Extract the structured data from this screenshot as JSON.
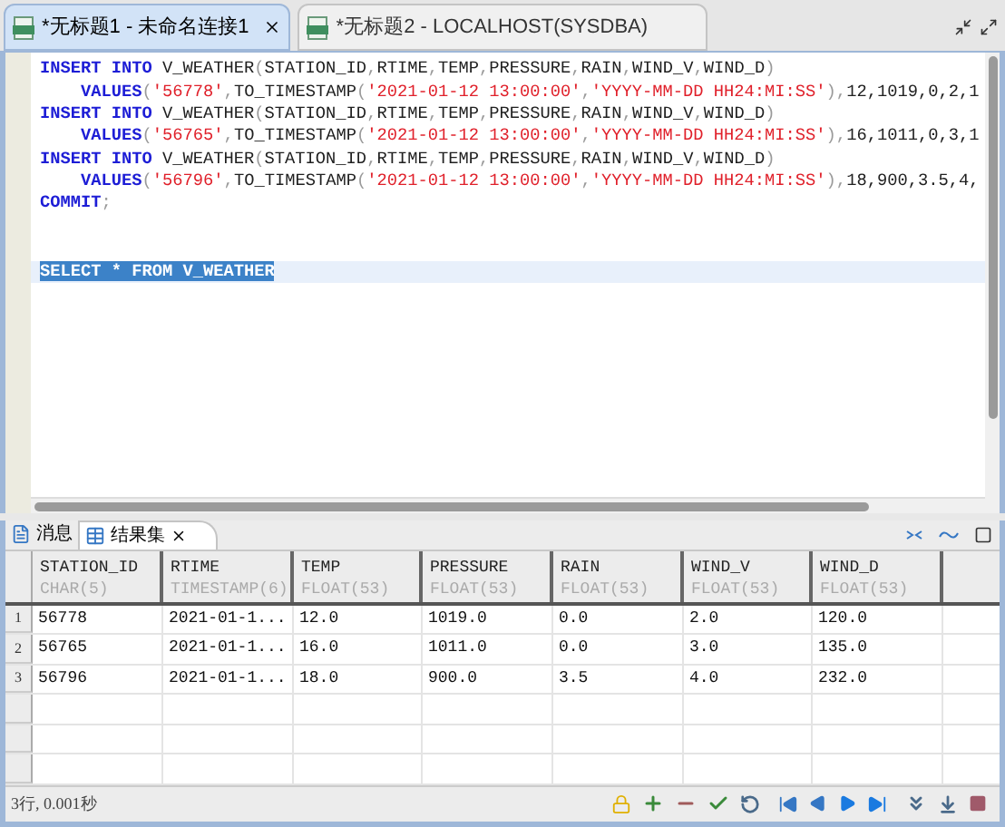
{
  "editor_tabs": [
    {
      "label": "*无标题1 - 未命名连接1",
      "selected": true,
      "closable": true
    },
    {
      "label": "*无标题2 - LOCALHOST(SYSDBA)",
      "selected": false,
      "closable": false
    }
  ],
  "sql_lines": [
    {
      "selected": false,
      "segments": [
        {
          "kind": "keyword",
          "text": "INSERT INTO"
        },
        {
          "kind": "plain",
          "text": " V_WEATHER"
        },
        {
          "kind": "punct",
          "text": "("
        },
        {
          "kind": "plain",
          "text": "STATION_ID"
        },
        {
          "kind": "punct",
          "text": ","
        },
        {
          "kind": "plain",
          "text": "RTIME"
        },
        {
          "kind": "punct",
          "text": ","
        },
        {
          "kind": "plain",
          "text": "TEMP"
        },
        {
          "kind": "punct",
          "text": ","
        },
        {
          "kind": "plain",
          "text": "PRESSURE"
        },
        {
          "kind": "punct",
          "text": ","
        },
        {
          "kind": "plain",
          "text": "RAIN"
        },
        {
          "kind": "punct",
          "text": ","
        },
        {
          "kind": "plain",
          "text": "WIND_V"
        },
        {
          "kind": "punct",
          "text": ","
        },
        {
          "kind": "plain",
          "text": "WIND_D"
        },
        {
          "kind": "punct",
          "text": ")"
        }
      ]
    },
    {
      "selected": false,
      "segments": [
        {
          "kind": "keyword",
          "text": "    VALUES"
        },
        {
          "kind": "punct",
          "text": "("
        },
        {
          "kind": "string",
          "text": "'56778'"
        },
        {
          "kind": "punct",
          "text": ","
        },
        {
          "kind": "plain",
          "text": "TO_TIMESTAMP"
        },
        {
          "kind": "punct",
          "text": "("
        },
        {
          "kind": "string",
          "text": "'2021-01-12 13:00:00'"
        },
        {
          "kind": "punct",
          "text": ","
        },
        {
          "kind": "string",
          "text": "'YYYY-MM-DD HH24:MI:SS'"
        },
        {
          "kind": "punct",
          "text": "),"
        },
        {
          "kind": "plain",
          "text": "12,1019,0,2,1"
        }
      ]
    },
    {
      "selected": false,
      "segments": [
        {
          "kind": "keyword",
          "text": "INSERT INTO"
        },
        {
          "kind": "plain",
          "text": " V_WEATHER"
        },
        {
          "kind": "punct",
          "text": "("
        },
        {
          "kind": "plain",
          "text": "STATION_ID"
        },
        {
          "kind": "punct",
          "text": ","
        },
        {
          "kind": "plain",
          "text": "RTIME"
        },
        {
          "kind": "punct",
          "text": ","
        },
        {
          "kind": "plain",
          "text": "TEMP"
        },
        {
          "kind": "punct",
          "text": ","
        },
        {
          "kind": "plain",
          "text": "PRESSURE"
        },
        {
          "kind": "punct",
          "text": ","
        },
        {
          "kind": "plain",
          "text": "RAIN"
        },
        {
          "kind": "punct",
          "text": ","
        },
        {
          "kind": "plain",
          "text": "WIND_V"
        },
        {
          "kind": "punct",
          "text": ","
        },
        {
          "kind": "plain",
          "text": "WIND_D"
        },
        {
          "kind": "punct",
          "text": ")"
        }
      ]
    },
    {
      "selected": false,
      "segments": [
        {
          "kind": "keyword",
          "text": "    VALUES"
        },
        {
          "kind": "punct",
          "text": "("
        },
        {
          "kind": "string",
          "text": "'56765'"
        },
        {
          "kind": "punct",
          "text": ","
        },
        {
          "kind": "plain",
          "text": "TO_TIMESTAMP"
        },
        {
          "kind": "punct",
          "text": "("
        },
        {
          "kind": "string",
          "text": "'2021-01-12 13:00:00'"
        },
        {
          "kind": "punct",
          "text": ","
        },
        {
          "kind": "string",
          "text": "'YYYY-MM-DD HH24:MI:SS'"
        },
        {
          "kind": "punct",
          "text": "),"
        },
        {
          "kind": "plain",
          "text": "16,1011,0,3,1"
        }
      ]
    },
    {
      "selected": false,
      "segments": [
        {
          "kind": "keyword",
          "text": "INSERT INTO"
        },
        {
          "kind": "plain",
          "text": " V_WEATHER"
        },
        {
          "kind": "punct",
          "text": "("
        },
        {
          "kind": "plain",
          "text": "STATION_ID"
        },
        {
          "kind": "punct",
          "text": ","
        },
        {
          "kind": "plain",
          "text": "RTIME"
        },
        {
          "kind": "punct",
          "text": ","
        },
        {
          "kind": "plain",
          "text": "TEMP"
        },
        {
          "kind": "punct",
          "text": ","
        },
        {
          "kind": "plain",
          "text": "PRESSURE"
        },
        {
          "kind": "punct",
          "text": ","
        },
        {
          "kind": "plain",
          "text": "RAIN"
        },
        {
          "kind": "punct",
          "text": ","
        },
        {
          "kind": "plain",
          "text": "WIND_V"
        },
        {
          "kind": "punct",
          "text": ","
        },
        {
          "kind": "plain",
          "text": "WIND_D"
        },
        {
          "kind": "punct",
          "text": ")"
        }
      ]
    },
    {
      "selected": false,
      "segments": [
        {
          "kind": "keyword",
          "text": "    VALUES"
        },
        {
          "kind": "punct",
          "text": "("
        },
        {
          "kind": "string",
          "text": "'56796'"
        },
        {
          "kind": "punct",
          "text": ","
        },
        {
          "kind": "plain",
          "text": "TO_TIMESTAMP"
        },
        {
          "kind": "punct",
          "text": "("
        },
        {
          "kind": "string",
          "text": "'2021-01-12 13:00:00'"
        },
        {
          "kind": "punct",
          "text": ","
        },
        {
          "kind": "string",
          "text": "'YYYY-MM-DD HH24:MI:SS'"
        },
        {
          "kind": "punct",
          "text": "),"
        },
        {
          "kind": "plain",
          "text": "18,900,3.5,4,"
        }
      ]
    },
    {
      "selected": false,
      "segments": [
        {
          "kind": "keyword",
          "text": "COMMIT"
        },
        {
          "kind": "punct",
          "text": ";"
        }
      ]
    },
    {
      "selected": false
    },
    {
      "selected": false
    },
    {
      "selected": true,
      "segments": [
        {
          "kind": "keyword",
          "text": "SELECT * FROM V_WEATHER"
        }
      ]
    }
  ],
  "result_tabs": [
    {
      "label": "消息",
      "selected": false,
      "closable": false
    },
    {
      "label": "结果集",
      "selected": true,
      "closable": true
    }
  ],
  "table": {
    "columns": [
      {
        "name": "STATION_ID",
        "type": "CHAR(5)"
      },
      {
        "name": "RTIME",
        "type": "TIMESTAMP(6)"
      },
      {
        "name": "TEMP",
        "type": "FLOAT(53)"
      },
      {
        "name": "PRESSURE",
        "type": "FLOAT(53)"
      },
      {
        "name": "RAIN",
        "type": "FLOAT(53)"
      },
      {
        "name": "WIND_V",
        "type": "FLOAT(53)"
      },
      {
        "name": "WIND_D",
        "type": "FLOAT(53)"
      }
    ],
    "rows": [
      {
        "number": "1",
        "cells": [
          "56778",
          "2021-01-1...",
          "12.0",
          "1019.0",
          "0.0",
          "2.0",
          "120.0"
        ]
      },
      {
        "number": "2",
        "cells": [
          "56765",
          "2021-01-1...",
          "16.0",
          "1011.0",
          "0.0",
          "3.0",
          "135.0"
        ]
      },
      {
        "number": "3",
        "cells": [
          "56796",
          "2021-01-1...",
          "18.0",
          "900.0",
          "3.5",
          "4.0",
          "232.0"
        ]
      }
    ]
  },
  "status": "3行, 0.001秒"
}
